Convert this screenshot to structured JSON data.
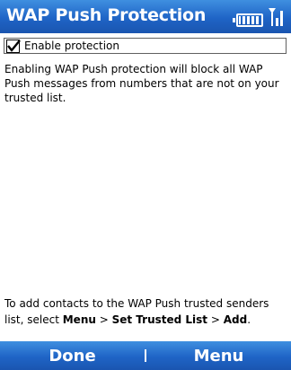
{
  "title_bar": {
    "title": "WAP Push Protection",
    "icons": [
      "battery-icon",
      "signal-icon"
    ]
  },
  "checkbox": {
    "label": "Enable protection",
    "checked": true
  },
  "description": "Enabling WAP Push protection will block all WAP Push messages from numbers that are not on your trusted list.",
  "hint": {
    "prefix": "To add contacts to the WAP Push trusted senders list, select ",
    "menu": "Menu",
    "sep1": " > ",
    "set_trusted_list": "Set Trusted List",
    "sep2": " > ",
    "add": "Add",
    "suffix": "."
  },
  "softkeys": {
    "left": "Done",
    "right": "Menu"
  },
  "colors": {
    "bar": "#1f64c6",
    "text_on_bar": "#ffffff"
  }
}
